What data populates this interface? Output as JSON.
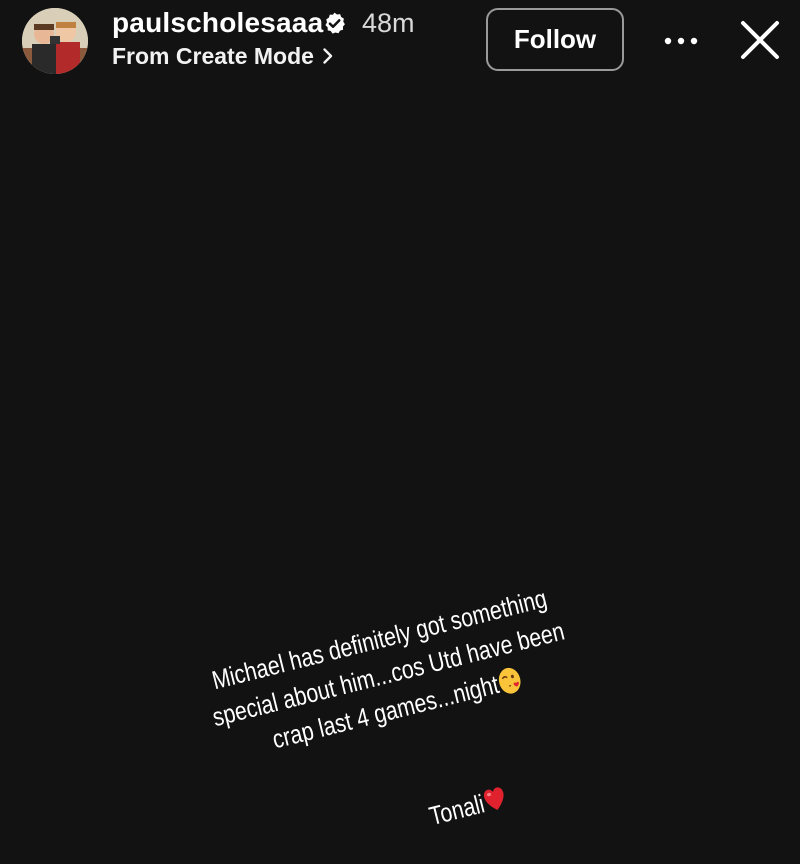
{
  "header": {
    "username": "paulscholesaaa",
    "time": "48m",
    "subtitle": "From Create Mode",
    "follow_label": "Follow",
    "icons": {
      "avatar": "profile-avatar",
      "verified": "verified-badge-icon",
      "subtitle_arrow": "chevron-right-icon",
      "more": "more-horizontal-icon",
      "close": "close-icon"
    }
  },
  "story": {
    "caption_lines": [
      "Michael has definitely got something",
      "special about him...cos Utd have been",
      "crap last 4 games...night"
    ],
    "caption_emoji": "kissing-face-emoji",
    "signoff": "Tonali",
    "signoff_emoji": "red-heart-emoji"
  },
  "colors": {
    "background": "#121212",
    "text": "#ffffff",
    "follow_border": "#9a9a9a",
    "verified": "#ffffff",
    "heart": "#e0222f",
    "emoji_face": "#f9c43a"
  }
}
